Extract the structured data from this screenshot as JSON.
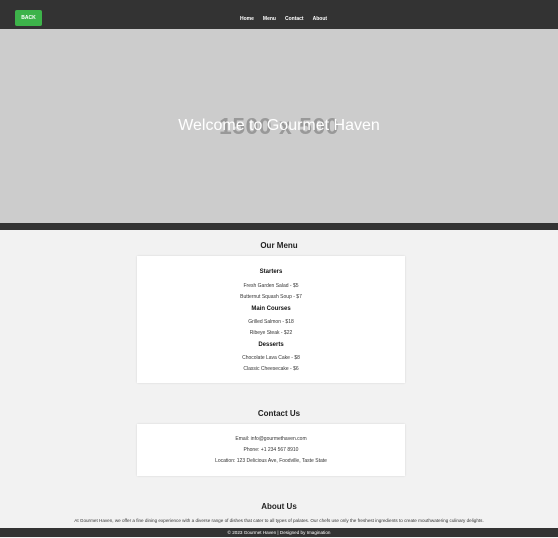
{
  "header": {
    "back_label": "BACK",
    "nav": [
      "Home",
      "Menu",
      "Contact",
      "About"
    ]
  },
  "hero": {
    "placeholder_text": "1500 x 500",
    "title": "Welcome to Gourmet Haven"
  },
  "menu": {
    "title": "Our Menu",
    "categories": [
      {
        "name": "Starters",
        "items": [
          "Fresh Garden Salad - $5",
          "Butternut Squash Soup - $7"
        ]
      },
      {
        "name": "Main Courses",
        "items": [
          "Grilled Salmon - $18",
          "Ribeye Steak - $22"
        ]
      },
      {
        "name": "Desserts",
        "items": [
          "Chocolate Lava Cake - $8",
          "Classic Cheesecake - $6"
        ]
      }
    ]
  },
  "contact": {
    "title": "Contact Us",
    "email": "Email: info@gourmethaven.com",
    "phone": "Phone: +1 234 567 8910",
    "location": "Location: 123 Delicious Ave, Foodville, Taste State"
  },
  "about": {
    "title": "About Us",
    "text": "At Gourmet Haven, we offer a fine dining experience with a diverse range of dishes that cater to all types of palates. Our chefs use only the freshest ingredients to create mouthwatering culinary delights."
  },
  "footer": {
    "text": "© 2023 Gourmet Haven | Designed by Imagination"
  },
  "colors": {
    "topbar": "#333333",
    "back_button": "#3db34a",
    "hero": "#cccccc",
    "page_bg": "#f2f2f2",
    "card_bg": "#ffffff"
  }
}
